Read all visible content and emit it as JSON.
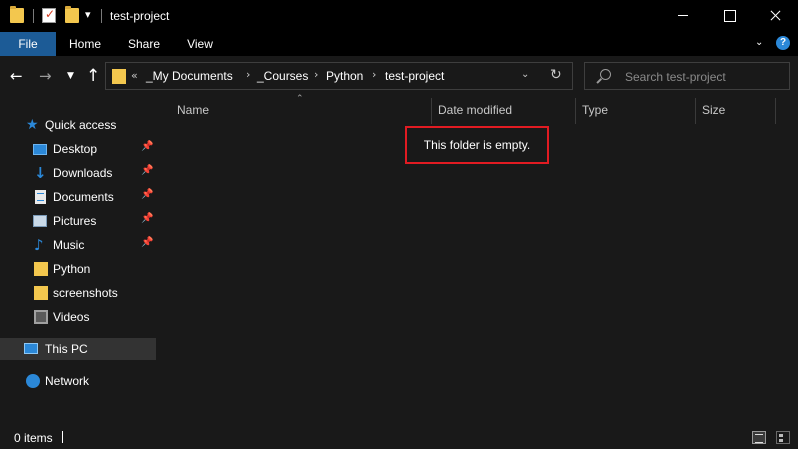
{
  "window": {
    "title": "test-project",
    "quick_access_dropdown": "▾"
  },
  "ribbon": {
    "tabs": [
      {
        "label": "File"
      },
      {
        "label": "Home"
      },
      {
        "label": "Share"
      },
      {
        "label": "View"
      }
    ],
    "help_label": "?"
  },
  "navigation": {
    "breadcrumb_overflow": "«",
    "breadcrumbs": [
      "_My Documents",
      "_Courses",
      "Python",
      "test-project"
    ],
    "search_placeholder": "Search test-project"
  },
  "sidebar": {
    "items": [
      {
        "label": "Quick access",
        "icon": "star-icon"
      },
      {
        "label": "Desktop",
        "icon": "desktop-icon",
        "pinned": true
      },
      {
        "label": "Downloads",
        "icon": "download-icon",
        "pinned": true
      },
      {
        "label": "Documents",
        "icon": "documents-icon",
        "pinned": true
      },
      {
        "label": "Pictures",
        "icon": "pictures-icon",
        "pinned": true
      },
      {
        "label": "Music",
        "icon": "music-icon",
        "pinned": true
      },
      {
        "label": "Python",
        "icon": "folder-icon"
      },
      {
        "label": "screenshots",
        "icon": "folder-icon"
      },
      {
        "label": "Videos",
        "icon": "videos-icon"
      },
      {
        "label": "This PC",
        "icon": "computer-icon",
        "selected": true
      },
      {
        "label": "Network",
        "icon": "network-icon"
      }
    ]
  },
  "file_list": {
    "columns": [
      "Name",
      "Date modified",
      "Type",
      "Size"
    ],
    "empty_message": "This folder is empty."
  },
  "status": {
    "item_count": "0 items"
  },
  "colors": {
    "background": "#191919",
    "titlebar": "#000000",
    "file_tab": "#1c5b96",
    "folder": "#f3c74e",
    "accent": "#2b88d8",
    "highlight_box": "#e11b22"
  }
}
